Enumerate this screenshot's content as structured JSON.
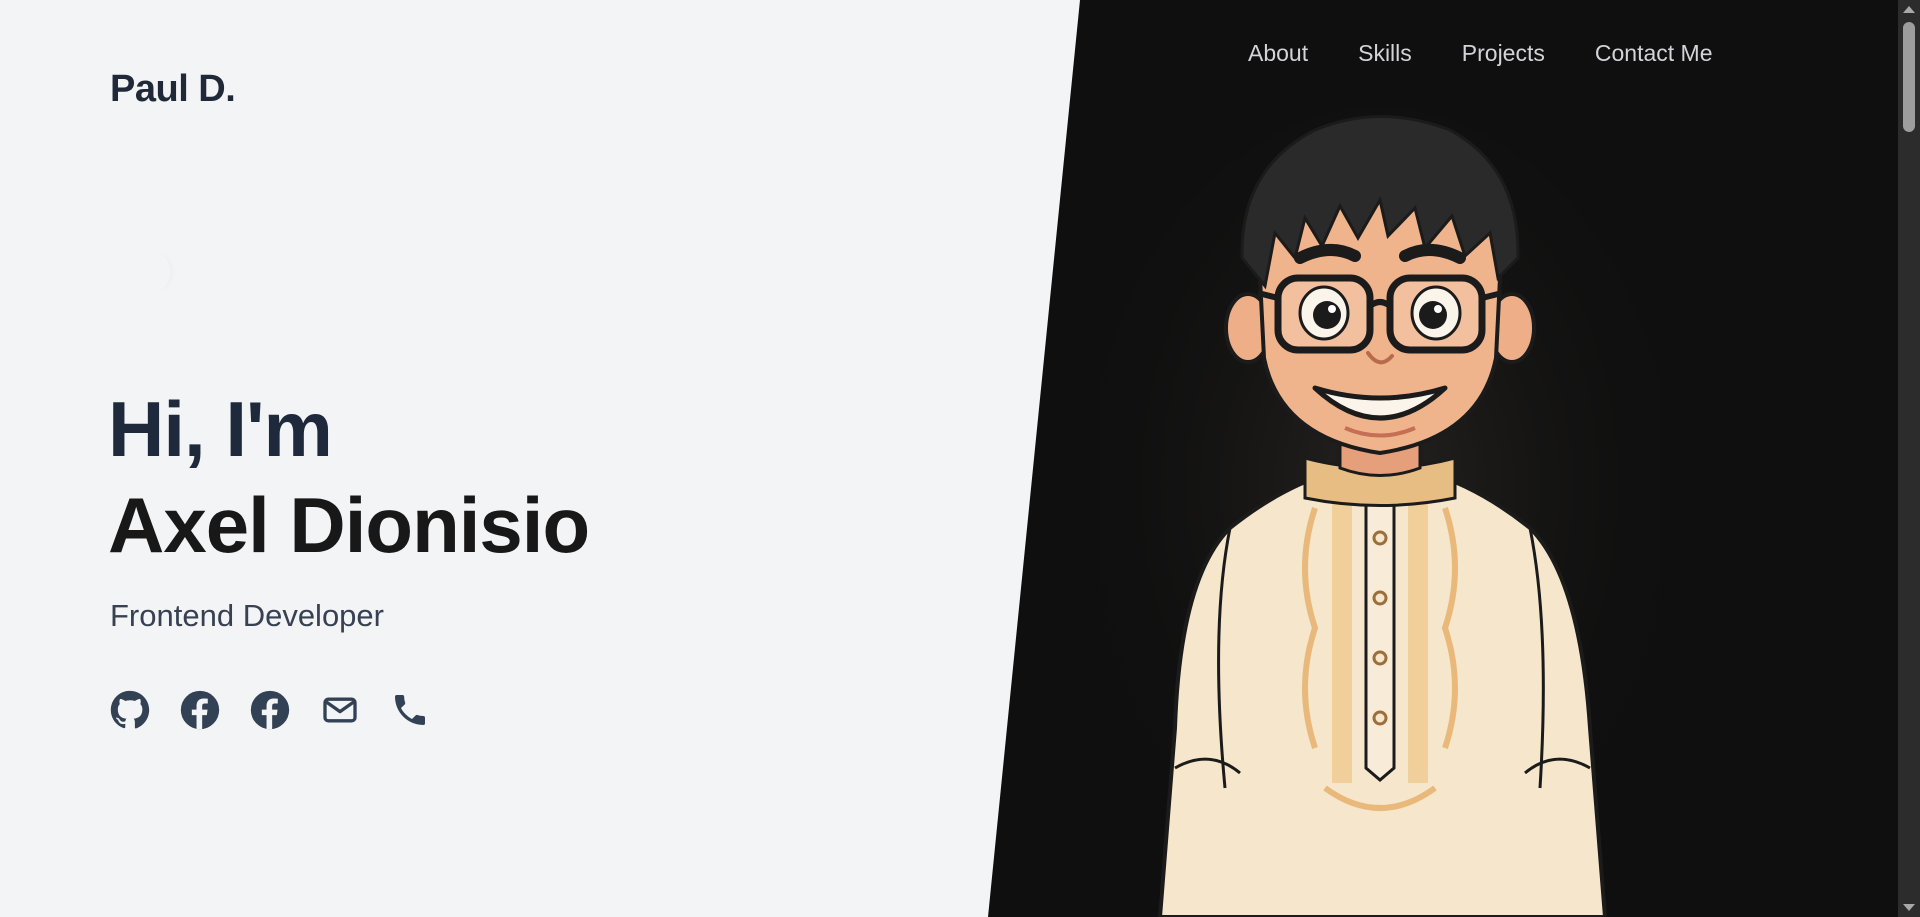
{
  "header": {
    "logo": "Paul D."
  },
  "nav": {
    "items": [
      {
        "label": "About"
      },
      {
        "label": "Skills"
      },
      {
        "label": "Projects"
      },
      {
        "label": "Contact Me"
      }
    ]
  },
  "hero": {
    "greeting": "Hi, I'm",
    "name": "Axel Dionisio",
    "role": "Frontend Developer"
  },
  "socials": [
    {
      "icon": "github-icon"
    },
    {
      "icon": "facebook-icon"
    },
    {
      "icon": "facebook-icon"
    },
    {
      "icon": "mail-icon"
    },
    {
      "icon": "phone-icon"
    }
  ],
  "colors": {
    "light_bg": "#f3f4f6",
    "dark_bg": "#0f0f0f",
    "heading": "#1e293b",
    "nav_text": "#d4d4d8",
    "shirt": "#f6e6cc",
    "embroidery": "#e8b97a"
  }
}
